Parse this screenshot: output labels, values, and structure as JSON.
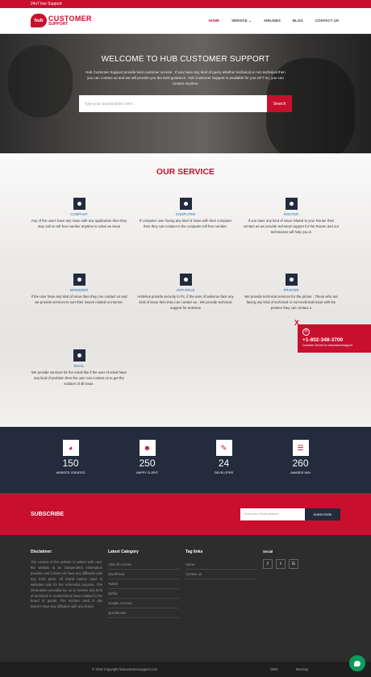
{
  "topbar": {
    "text": "24x7 live Support"
  },
  "logo": {
    "badge": "hub",
    "line1": "CUSTOMER",
    "line2": "SUPPORT"
  },
  "nav": {
    "items": [
      "HOME",
      "SERVICE",
      "AIRLINES",
      "BLOG",
      "CONTACT US"
    ],
    "active": "HOME"
  },
  "hero": {
    "title": "WELCOME TO HUB CUSTOMER SUPPORT",
    "description": "Hub Customer Support provide best customer service . If you have any kind of query whether technical or non technical then you can contact us and we will provide you the best guidance. Hub Customer Support is available for you 24*7 so, you can contact anytime.",
    "search_placeholder": "Type your issue/problem here ....",
    "search_button": "Search"
  },
  "services": {
    "title": "OUR SERVICE",
    "items": [
      {
        "name": "COMPANY",
        "desc": "Any of the users have any issue with any application then they may call on toll-free number anytime to solve an issue"
      },
      {
        "name": "COMPUTER",
        "desc": "If computer user facing any kind of issue with their computer then they can contact to the computer toll free number."
      },
      {
        "name": "ROUTER",
        "desc": "If you have any kind of issue related to your Router then contact us we provide technical support for the Router and our technicians will help you in"
      },
      {
        "name": "BROWSER",
        "desc": "If the user have any kind of issue then they can contact us and we provide services to sort their issues related to internet."
      },
      {
        "name": "ANTIVIRUS",
        "desc": "Antivirus provide security to Pc, if the user of antivirus face any kind of issue then they can contact us . We provide technical support for antivirus"
      },
      {
        "name": "PRINTER",
        "desc": "We provide technical services for the printer . These who are facing any kind of technical or non-technical issue with the printers they can contact u"
      },
      {
        "name": "EMAIL",
        "desc": "We provide services for the email like if the user of email have any kind of problem then the user can contact us to get the solution of all issue."
      }
    ]
  },
  "call_box": {
    "close": "X",
    "number": "+1-802-348-3700",
    "subtitle": "Customer Service for hubcustomersupport"
  },
  "stats": [
    {
      "icon": "globe-icon",
      "glyph": "◕",
      "number": "150",
      "label": "WEBSITE CREATED"
    },
    {
      "icon": "users-icon",
      "glyph": "☻",
      "number": "250",
      "label": "HAPPY CLIENT"
    },
    {
      "icon": "pencil-icon",
      "glyph": "✎",
      "number": "24",
      "label": "DEVELOPER"
    },
    {
      "icon": "list-icon",
      "glyph": "☰",
      "number": "260",
      "label": "AWARDS WIN"
    }
  ],
  "subscribe": {
    "title": "SUBSCRIBE",
    "placeholder": "Enter your Email address",
    "button": "SUBSCRIBE"
  },
  "footer": {
    "disclaimer_title": "Disclaimer:",
    "disclaimer_text": "The content of the website is written with care. the website is an independent information provider and it does not have any affiliation with any third party. All brand names used in websites only for the referential purpose. The information provided by us to resolve any kind of technical or nontechnical issue related to the brand or goods. The number used is site doesn't have any affiliation with any brand.",
    "category_title": "Latest Category",
    "categories": [
      "CBS All Access",
      "WordPress",
      "Twitter",
      "Netflix",
      "Google Account",
      "QuickBooks"
    ],
    "tags_title": "Tag links",
    "tags": [
      "Home",
      "Contact us"
    ],
    "social_title": "Social",
    "social": [
      {
        "icon": "facebook-icon",
        "glyph": "f"
      },
      {
        "icon": "twitter-icon",
        "glyph": "t"
      },
      {
        "icon": "google-icon",
        "glyph": "G"
      }
    ]
  },
  "bottom": {
    "copyright": "© 2019 Copyright hubcustomersupport.com",
    "links": [
      "DMC",
      "Sitemap"
    ]
  },
  "colors": {
    "brand_red": "#c8102e",
    "navy": "#232b3c",
    "link_blue": "#2a6db3",
    "chat_green": "#0e9c5b"
  }
}
